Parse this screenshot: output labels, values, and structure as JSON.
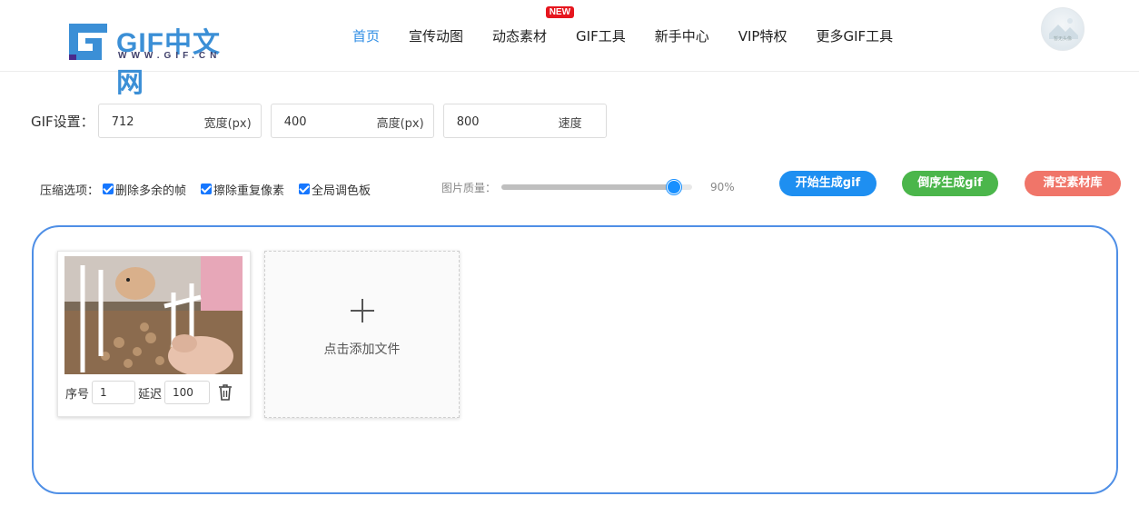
{
  "header": {
    "logo_text": "GIF中文网",
    "logo_sub": "WWW.GIF.CN",
    "nav": [
      {
        "label": "首页",
        "active": true
      },
      {
        "label": "宣传动图"
      },
      {
        "label": "动态素材",
        "badge": "NEW"
      },
      {
        "label": "GIF工具"
      },
      {
        "label": "新手中心"
      },
      {
        "label": "VIP特权"
      },
      {
        "label": "更多GIF工具"
      }
    ],
    "avatar_icon": "user-avatar-icon",
    "avatar_text": "暂无头像"
  },
  "settings": {
    "label": "GIF设置：",
    "width": {
      "value": "712",
      "unit": "宽度(px)"
    },
    "height": {
      "value": "400",
      "unit": "高度(px)"
    },
    "speed": {
      "value": "800",
      "unit": "速度"
    }
  },
  "compress": {
    "label": "压缩选项：",
    "options": [
      {
        "label": "删除多余的帧",
        "checked": true
      },
      {
        "label": "擦除重复像素",
        "checked": true
      },
      {
        "label": "全局调色板",
        "checked": true
      }
    ]
  },
  "quality": {
    "label": "图片质量：",
    "value_text": "90%",
    "value": 0.9
  },
  "buttons": {
    "start": "开始生成gif",
    "reverse": "倒序生成gif",
    "clear": "清空素材库"
  },
  "frames": [
    {
      "seq_label": "序号",
      "seq": "1",
      "delay_label": "延迟",
      "delay": "100"
    }
  ],
  "add": {
    "label": "点击添加文件"
  },
  "colors": {
    "accent": "#1e8ff1",
    "green": "#4bb64b",
    "red": "#f07569",
    "border": "#4f8fe6"
  }
}
